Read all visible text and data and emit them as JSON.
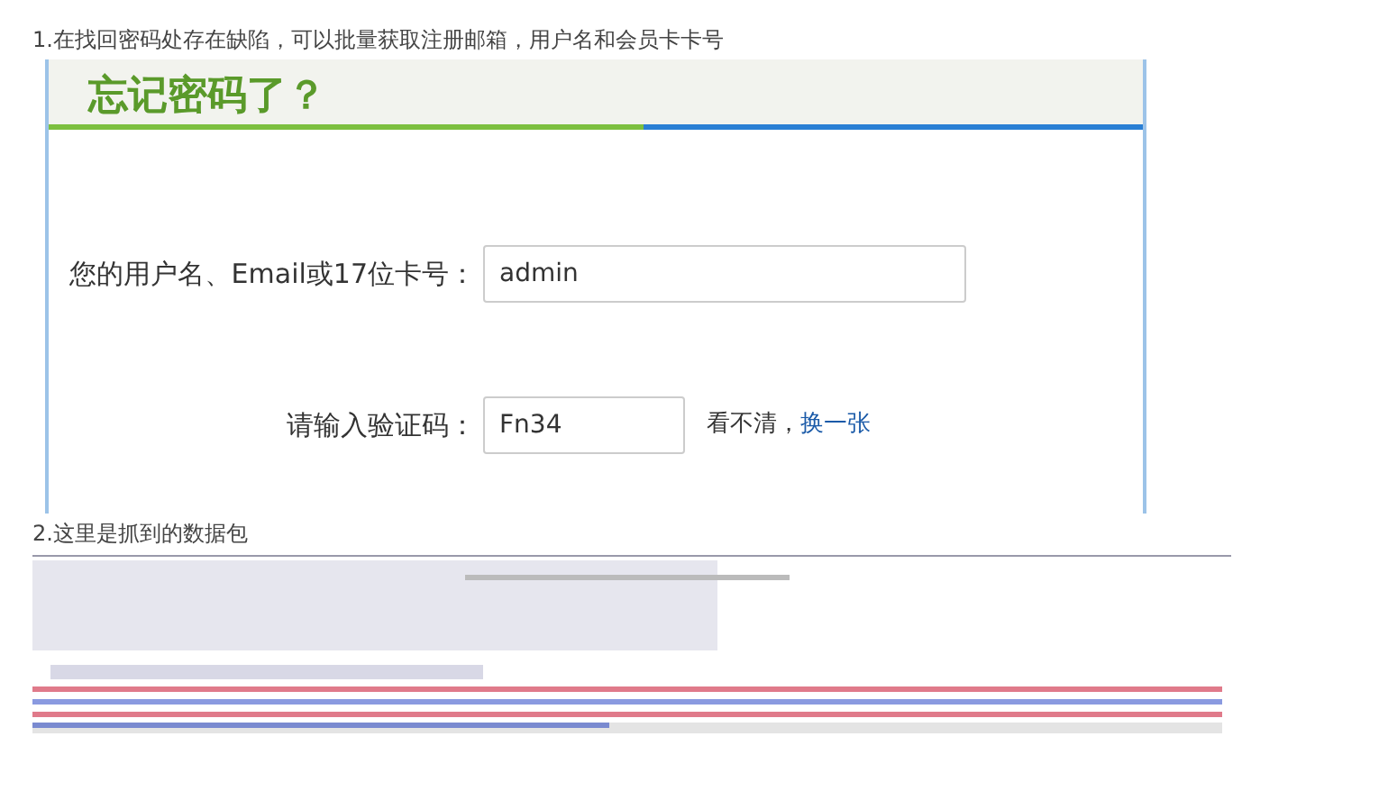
{
  "captions": [
    "1.在找回密码处存在缺陷，可以批量获取注册邮箱，用户名和会员卡卡号",
    "2.这里是抓到的数据包"
  ],
  "form_screenshot": {
    "title": "忘记密码了？",
    "fields": [
      {
        "label": "您的用户名、Email或17位卡号：",
        "value": "admin",
        "kind": "wide"
      },
      {
        "label": "请输入验证码：",
        "value": "Fn34",
        "kind": "captcha",
        "hint": "看不清，",
        "link": "换一张"
      }
    ]
  }
}
